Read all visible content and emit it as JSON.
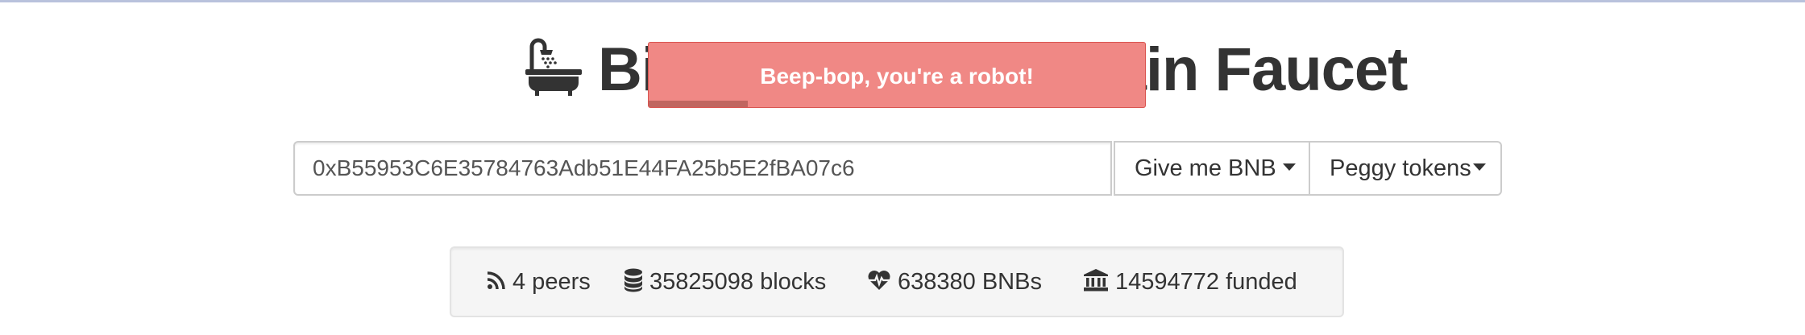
{
  "header": {
    "title": "Binance Smart Chain Faucet",
    "icon": "bath-icon"
  },
  "toast": {
    "message": "Beep-bop, you're a robot!",
    "progress": 0.2,
    "color": "#f08885"
  },
  "form": {
    "address_value": "0xB55953C6E35784763Adb51E44FA25b5E2fBA07c6",
    "give_bnb_label": "Give me BNB",
    "peggy_label": "Peggy tokens"
  },
  "stats": {
    "peers": "4 peers",
    "blocks": "35825098 blocks",
    "bnbs": "638380 BNBs",
    "funded": "14594772 funded"
  }
}
